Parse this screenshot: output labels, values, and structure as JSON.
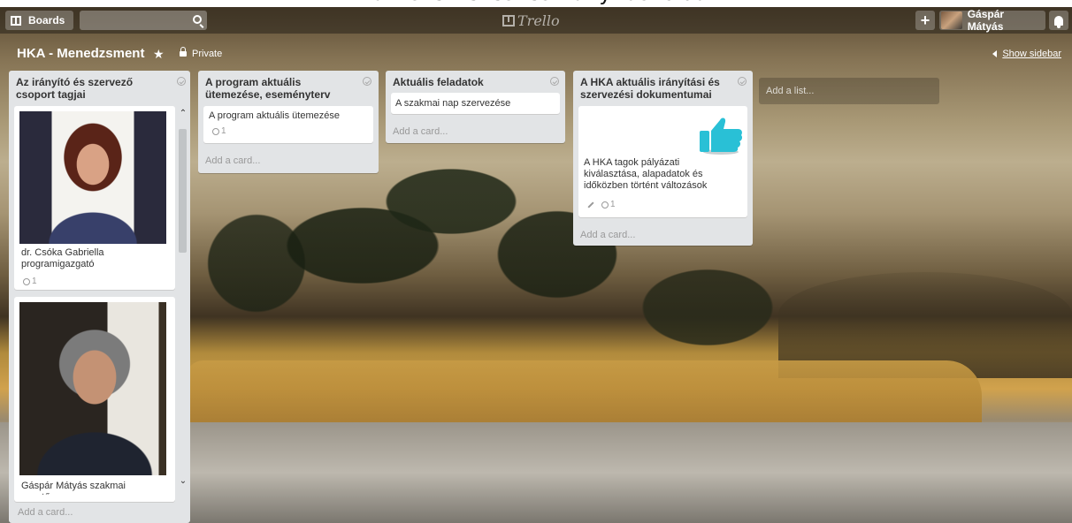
{
  "caption": "Zárt szervezési és irányítási oldal",
  "header": {
    "boards_label": "Boards",
    "search_value": "",
    "logo_text": "Trello",
    "add_label": "+",
    "member_name": "Gáspár Mátyás"
  },
  "board": {
    "title": "HKA - Menedzsment",
    "privacy": "Private",
    "show_sidebar": "Show sidebar"
  },
  "lists": [
    {
      "title": "Az irányító és szervező csoport tagjai",
      "cards": [
        {
          "text": "dr. Csóka Gabriella programigazgató",
          "attachments": "1"
        },
        {
          "text": "Gáspár Mátyás szakmai vezető"
        }
      ],
      "add_card": "Add a card..."
    },
    {
      "title": "A program aktuális ütemezése, eseményterv",
      "cards": [
        {
          "text": "A program aktuális ütemezése",
          "attachments": "1"
        }
      ],
      "add_card": "Add a card..."
    },
    {
      "title": "Aktuális feladatok",
      "cards": [
        {
          "text": "A szakmai nap szervezése"
        }
      ],
      "add_card": "Add a card..."
    },
    {
      "title": "A HKA aktuális irányítási és szervezési dokumentumai",
      "cards": [
        {
          "text": "A HKA tagok pályázati kiválasztása, alapadatok és időközben történt változások",
          "attachments": "1"
        }
      ],
      "add_card": "Add a card..."
    }
  ],
  "add_list_placeholder": "Add a list...",
  "colors": {
    "list_bg": "#e2e4e6",
    "thumbs_up": "#29c0d6"
  }
}
